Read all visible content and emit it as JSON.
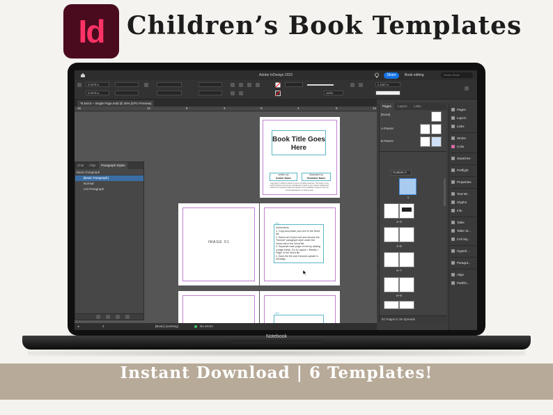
{
  "header": {
    "app_logo_text": "Id",
    "headline": "Children’s Book Templates"
  },
  "banner": {
    "text": "Instant Download | 6 Templates!"
  },
  "laptop": {
    "label": "Notebook"
  },
  "indesign": {
    "window_title": "Adobe InDesign 2023",
    "share_label": "Share",
    "workspace": "Book editing",
    "stock_search": "Adobe Stock",
    "control": {
      "x_value": "0.9375 in",
      "y_value": "0.9375 in",
      "zoom_value": "100%",
      "stroke_value": "0.1667 in"
    },
    "doc_tab": "*8.5x8.5 – Single Page.indd @ 25% [GPU Preview]",
    "ruler_marks": [
      "16",
      "12",
      "8",
      "4",
      "0",
      "4",
      "8",
      "12"
    ],
    "pages": {
      "cover_title": "Book Title Goes Here",
      "written_by": "written by",
      "author_name": "Author Name",
      "illustrated_by": "illustrated by",
      "illustrator_name": "Illustrator Name",
      "fineprint": "Copyright © 2023 by Author's name. All rights reserved. This book or any portion thereof may not be reproduced or used in any manner whatsoever without the express written permission of the publisher except for the use of brief quotations in a book review.",
      "image_label": "IMAGE 01",
      "instructions_tag": "001",
      "instructions": "Instructions:\n1.  Copy and paste your text in the Word file\n2.  Select all of your text and choose the \"Normal\" paragraph style under the Home tab in the Word file\n3.  Separate each page of text by adding a page break. Go to Layout > Breaks > Page, in the Word file\n4.  Save the file and it should update in InDesign",
      "tag_002": "002"
    },
    "para_panel": {
      "tabs": [
        "Char",
        "Obje",
        "Paragraph Styles"
      ],
      "subheader": "Basic Paragraph",
      "items": [
        "[Basic Paragraph]",
        "Normal",
        "List Paragraph"
      ]
    },
    "status": {
      "page": "2",
      "style": "[Basic] (working)",
      "errors": "No errors"
    },
    "pages_panel": {
      "tabs": [
        "Pages",
        "Layers",
        "Links"
      ],
      "masters": [
        "[None]",
        "A-Parent",
        "B-Parent"
      ],
      "size_select": "Custom V",
      "spread_labels": [
        "1",
        "2–3",
        "4–5",
        "6–7",
        "8–9"
      ],
      "footer": "51 Pages in 26 Spreads"
    },
    "dock": [
      "Pages",
      "Layers",
      "Links",
      "Stroke",
      "Color",
      "Swatches",
      "Preflight",
      "Properties",
      "Text Wr...",
      "Glyphs",
      "Info",
      "Table",
      "Table St...",
      "Cell Sty...",
      "Hyperli...",
      "Paragra...",
      "Align",
      "Pathfin..."
    ]
  }
}
